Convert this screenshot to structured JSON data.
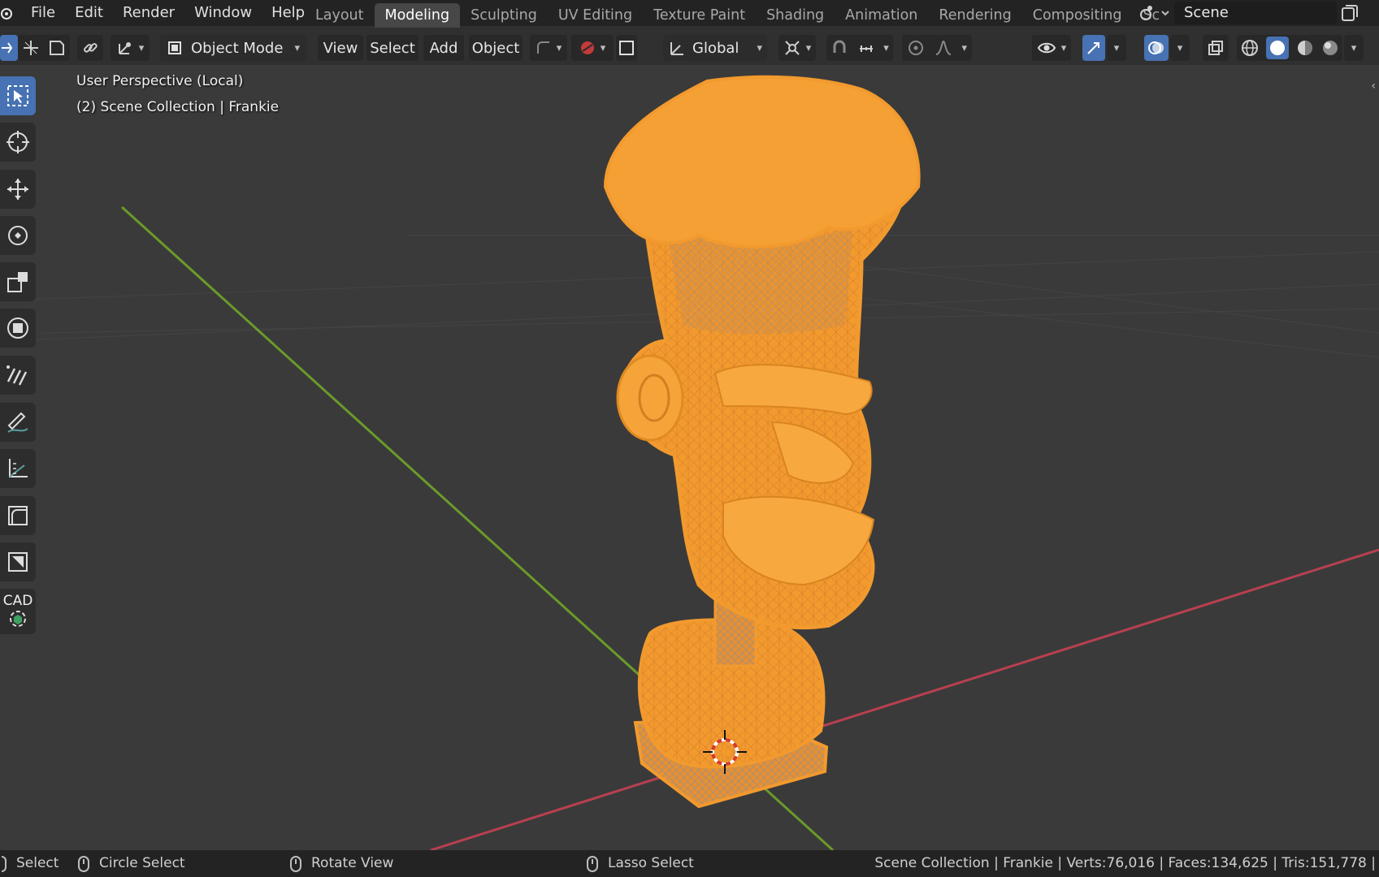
{
  "menu": {
    "items": [
      "File",
      "Edit",
      "Render",
      "Window",
      "Help"
    ]
  },
  "workspaces": {
    "tabs": [
      "Layout",
      "Modeling",
      "Sculpting",
      "UV Editing",
      "Texture Paint",
      "Shading",
      "Animation",
      "Rendering",
      "Compositing",
      "Sc"
    ],
    "active": "Modeling"
  },
  "scene": {
    "name": "Scene"
  },
  "header": {
    "mode": "Object Mode",
    "view": "View",
    "select": "Select",
    "add": "Add",
    "object": "Object",
    "orientation": "Global"
  },
  "viewport": {
    "perspective": "User Perspective (Local)",
    "collection": "(2) Scene Collection | Frankie",
    "object_color": "#f29a2e"
  },
  "toolbar": {
    "tools": [
      "select-box",
      "cursor",
      "move",
      "rotate",
      "scale",
      "transform",
      "annotate-lines",
      "annotate",
      "measure",
      "add-cube",
      "add-plane",
      "cad"
    ],
    "cad_label": "CAD"
  },
  "statusbar": {
    "select": "Select",
    "circle_select": "Circle Select",
    "rotate_view": "Rotate View",
    "lasso_select": "Lasso Select",
    "stats": "Scene Collection | Frankie | Verts:76,016 | Faces:134,625 | Tris:151,778 |"
  }
}
